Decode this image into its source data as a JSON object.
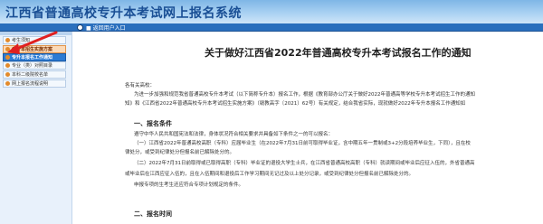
{
  "header": {
    "title": "江西省普通高校专升本考试网上报名系统"
  },
  "navbar": {
    "home_label": "■ 返回用户入口"
  },
  "sidebar": {
    "items": [
      {
        "label": "考生须知"
      },
      {
        "label": "专升本招生实施方案"
      },
      {
        "label": "专升本报名工作通知"
      },
      {
        "label": "专业（类）对照目录"
      },
      {
        "label": "本科二级院校名单"
      },
      {
        "label": "网上报名流程说明"
      }
    ]
  },
  "document": {
    "title": "关于做好江西省2022年普通高校专升本考试报名工作的通知",
    "salutation": "各有关高校：",
    "intro_line1": "为进一步加强和规范我省普通高校专升本考试（以下简称专升本）报名工作，根据《教育部办公厅关于做好2022年普通高等学校专升本考试招生工作的通知",
    "intro_line2": "知》和《江西省2022年普通高校专升本考试招生实施方案》（赣教高字〔2021〕62号）有关规定，结合我省实际，现就做好2022年专升本报名工作通知如",
    "section1_title": "一、报名条件",
    "s1_line1": "遵守中华人民共和国宪法和法律，身体状况符合相关要求并具备如下条件之一的可以报名：",
    "s1_line2": "（一）江西省2022年普通高校高职（专科）应届毕业生（在2022年7月31日前可取得毕业证，含中期五年一贯制或3+2分段培养毕业生，下同），且在校",
    "s1_line3": "律处分，或受到纪律处分但报名前已解除处分的。",
    "s1_line4": "（二）2022年7月31日前取得或已取得高职（专科）毕业证的退役大学生士兵，在江西省普通高校高职（专科）就读期间或毕业后应征入伍的，外省普通高",
    "s1_line5": "或毕业后在江西应征入伍的，且在入伍期间和退役后工作学习期间无记过及以上处分记录，或受到纪律处分但报名前已解除处分的。",
    "s1_line6": "申报专项的生考生还应符合专项计划规定的条件。",
    "section2_title": "二、报名时间"
  },
  "colors": {
    "header_gradient_top": "#7fb6e6",
    "navbar": "#2a6fbd",
    "active_item": "#fbd9b6",
    "focus_item": "#2b7bd4",
    "arrow": "#e02020",
    "title_color": "#1a4f95"
  }
}
